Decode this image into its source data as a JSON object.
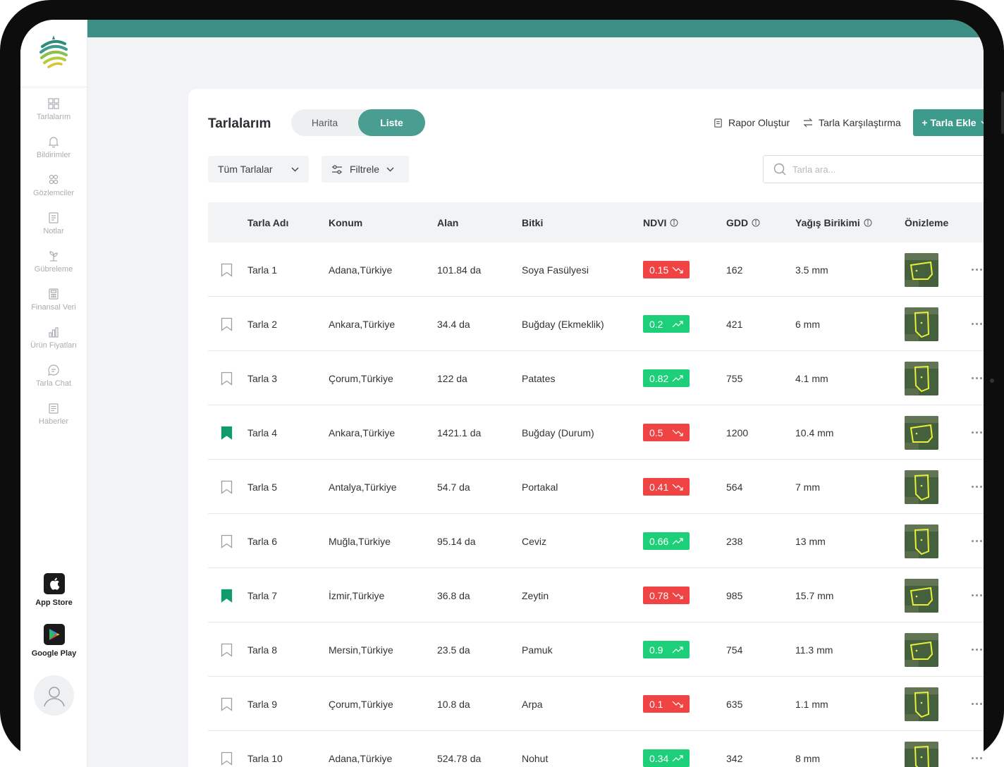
{
  "sidebar": {
    "items": [
      {
        "label": "Tarlalarım",
        "icon": "grid-icon"
      },
      {
        "label": "Bildirimler",
        "icon": "bell-icon"
      },
      {
        "label": "Gözlemciler",
        "icon": "users-icon"
      },
      {
        "label": "Notlar",
        "icon": "note-icon"
      },
      {
        "label": "Gübreleme",
        "icon": "fertilizer-icon"
      },
      {
        "label": "Finansal Veri",
        "icon": "calculator-icon"
      },
      {
        "label": "Ürün Fiyatları",
        "icon": "bar-chart-icon"
      },
      {
        "label": "Tarla Chat",
        "icon": "chat-icon"
      },
      {
        "label": "Haberler",
        "icon": "news-icon"
      }
    ],
    "app_store": "App Store",
    "google_play": "Google Play"
  },
  "header": {
    "title": "Tarlalarım",
    "view_toggle": [
      "Harita",
      "Liste"
    ],
    "active_view": "Liste",
    "report_button": "Rapor Oluştur",
    "compare_button": "Tarla Karşılaştırma",
    "add_button": "+ Tarla Ekle"
  },
  "filters": {
    "all_fields": "Tüm Tarlalar",
    "filter": "Filtrele",
    "search_placeholder": "Tarla ara..."
  },
  "table": {
    "columns": [
      "Tarla Adı",
      "Konum",
      "Alan",
      "Bitki",
      "NDVI",
      "GDD",
      "Yağış Birikimi",
      "Önizleme"
    ],
    "rows": [
      {
        "name": "Tarla 1",
        "location": "Adana,Türkiye",
        "area": "101.84 da",
        "crop": "Soya Fasülyesi",
        "ndvi": "0.15",
        "trend": "down",
        "gdd": "162",
        "rain": "3.5 mm",
        "bookmarked": false,
        "shape": "wide"
      },
      {
        "name": "Tarla 2",
        "location": "Ankara,Türkiye",
        "area": "34.4 da",
        "crop": "Buğday (Ekmeklik)",
        "ndvi": "0.2",
        "trend": "up",
        "gdd": "421",
        "rain": "6 mm",
        "bookmarked": false,
        "shape": "tall"
      },
      {
        "name": "Tarla 3",
        "location": "Çorum,Türkiye",
        "area": "122 da",
        "crop": "Patates",
        "ndvi": "0.82",
        "trend": "up",
        "gdd": "755",
        "rain": "4.1 mm",
        "bookmarked": false,
        "shape": "tall"
      },
      {
        "name": "Tarla 4",
        "location": "Ankara,Türkiye",
        "area": "1421.1 da",
        "crop": "Buğday (Durum)",
        "ndvi": "0.5",
        "trend": "down",
        "gdd": "1200",
        "rain": "10.4 mm",
        "bookmarked": true,
        "shape": "wide"
      },
      {
        "name": "Tarla 5",
        "location": "Antalya,Türkiye",
        "area": "54.7 da",
        "crop": "Portakal",
        "ndvi": "0.41",
        "trend": "down",
        "gdd": "564",
        "rain": "7 mm",
        "bookmarked": false,
        "shape": "tall"
      },
      {
        "name": "Tarla 6",
        "location": "Muğla,Türkiye",
        "area": "95.14 da",
        "crop": "Ceviz",
        "ndvi": "0.66",
        "trend": "up",
        "gdd": "238",
        "rain": "13 mm",
        "bookmarked": false,
        "shape": "tall"
      },
      {
        "name": "Tarla 7",
        "location": "İzmir,Türkiye",
        "area": "36.8 da",
        "crop": "Zeytin",
        "ndvi": "0.78",
        "trend": "down",
        "gdd": "985",
        "rain": "15.7 mm",
        "bookmarked": true,
        "shape": "wide"
      },
      {
        "name": "Tarla 8",
        "location": "Mersin,Türkiye",
        "area": "23.5 da",
        "crop": "Pamuk",
        "ndvi": "0.9",
        "trend": "up",
        "gdd": "754",
        "rain": "11.3 mm",
        "bookmarked": false,
        "shape": "wide"
      },
      {
        "name": "Tarla 9",
        "location": "Çorum,Türkiye",
        "area": "10.8 da",
        "crop": "Arpa",
        "ndvi": "0.1",
        "trend": "down",
        "gdd": "635",
        "rain": "1.1 mm",
        "bookmarked": false,
        "shape": "tall"
      },
      {
        "name": "Tarla 10",
        "location": "Adana,Türkiye",
        "area": "524.78 da",
        "crop": "Nohut",
        "ndvi": "0.34",
        "trend": "up",
        "gdd": "342",
        "rain": "8 mm",
        "bookmarked": false,
        "shape": "tall"
      }
    ]
  },
  "colors": {
    "brand": "#3d9b8c",
    "ndvi_down": "#f04444",
    "ndvi_up": "#1ecf7a",
    "bookmark_active": "#0f9b6c"
  }
}
